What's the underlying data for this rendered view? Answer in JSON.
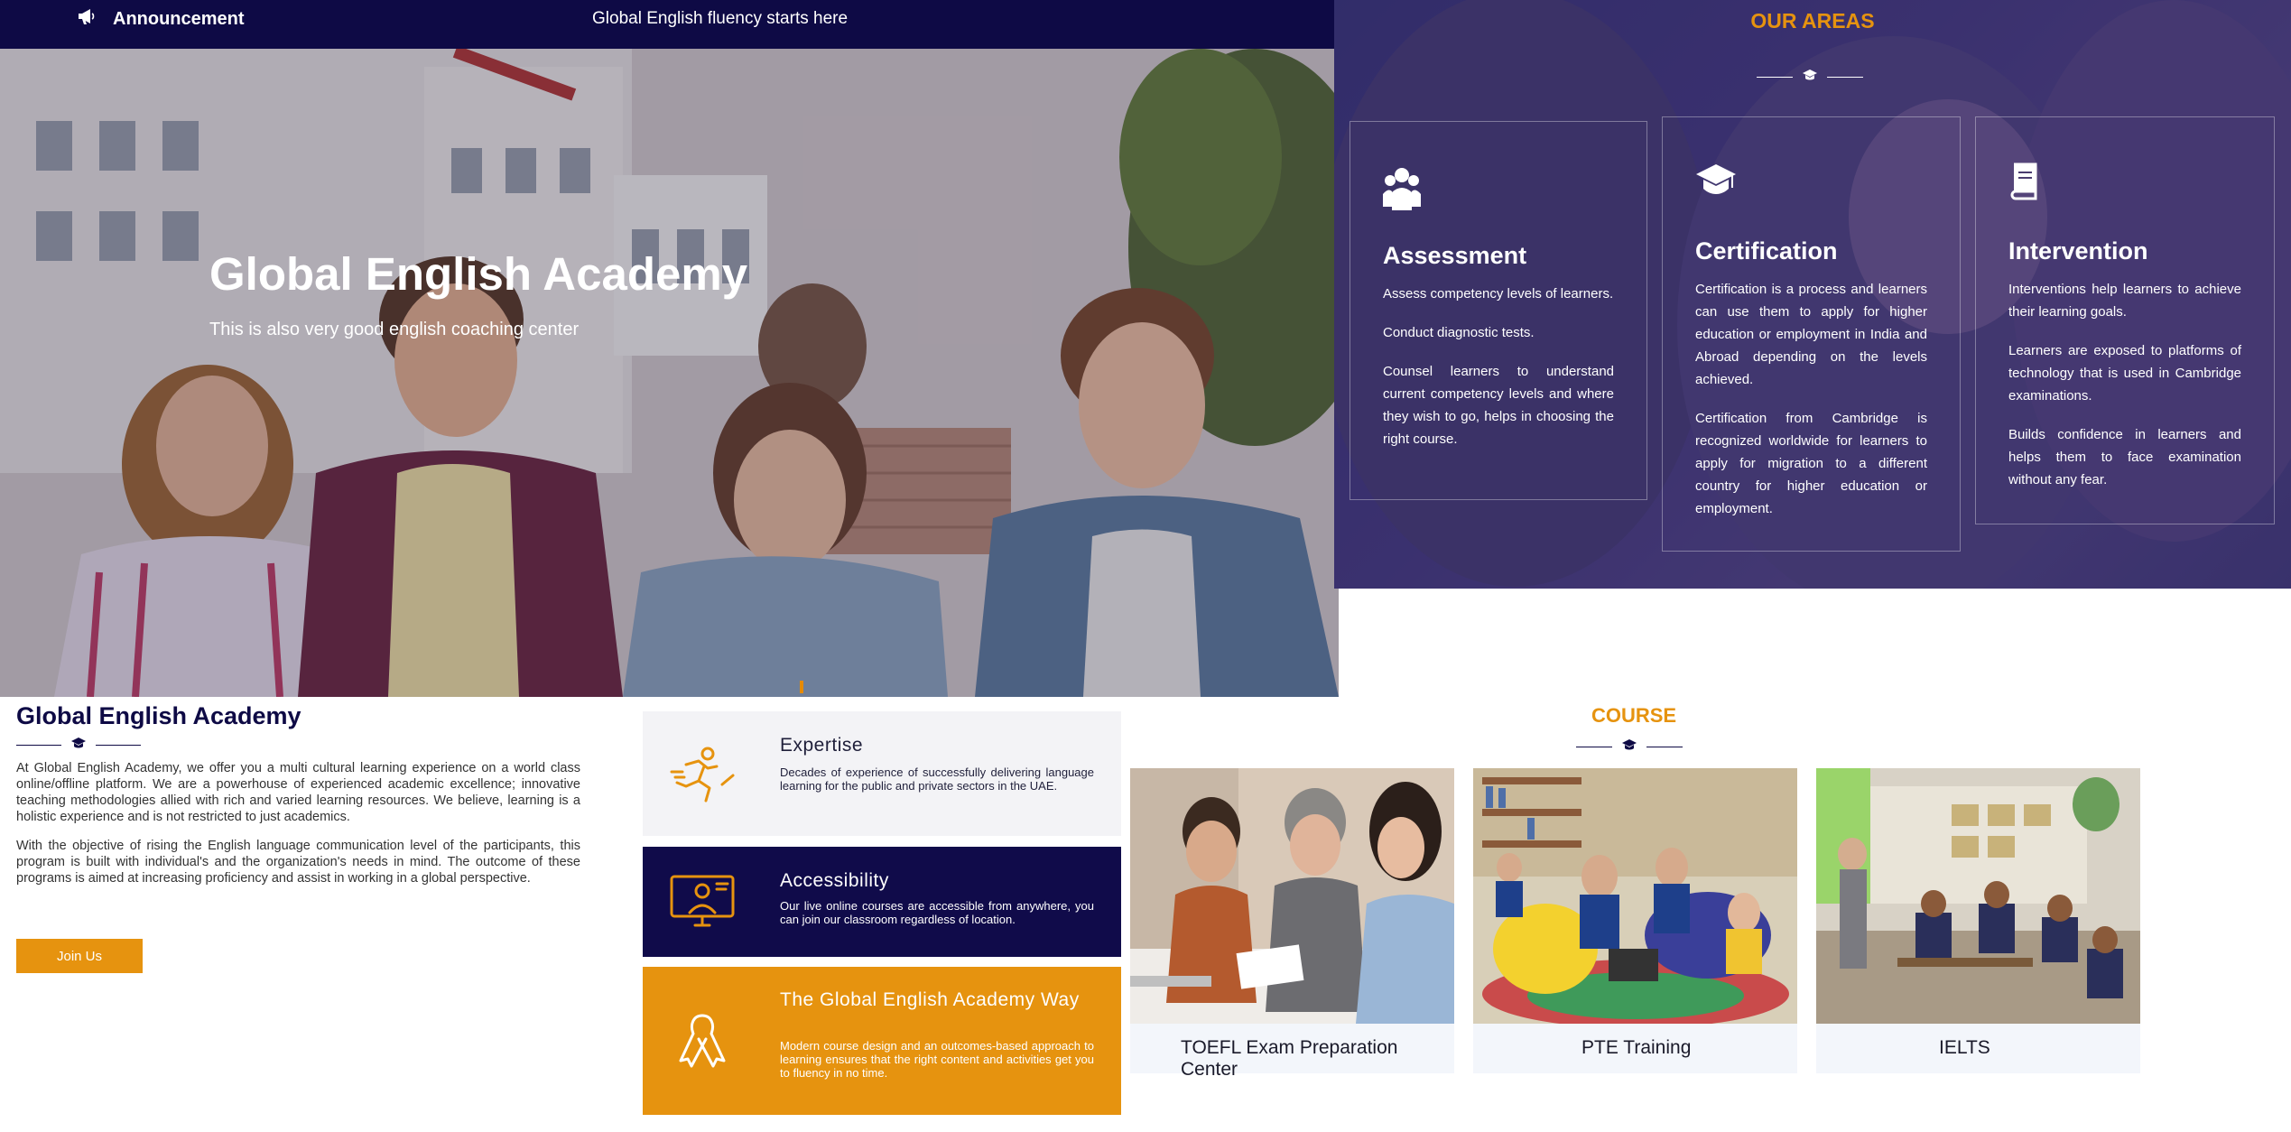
{
  "topbar": {
    "announcement": "Announcement",
    "tagline": "Global English fluency starts here"
  },
  "hero": {
    "title": "Global English Academy",
    "subtitle": "This is also very good english coaching center"
  },
  "areas": {
    "title": "OUR AREAS",
    "cards": [
      {
        "icon": "users-icon",
        "title": "Assessment",
        "paragraphs": [
          "Assess competency levels of learners.",
          "Conduct diagnostic tests.",
          "Counsel learners to understand current competency levels and where they wish to go, helps in choosing the right course."
        ]
      },
      {
        "icon": "graduation-cap-icon",
        "title": "Certification",
        "paragraphs": [
          "Certification is a process and learners can use them to apply for higher education or employment in India and Abroad depending on the levels achieved.",
          "Certification from Cambridge is recognized worldwide for learners to apply for migration to a different country for higher education or employment."
        ]
      },
      {
        "icon": "book-icon",
        "title": "Intervention",
        "paragraphs": [
          "Interventions help learners to achieve their learning goals.",
          "Learners are exposed to platforms of technology that is used in Cambridge examinations.",
          "Builds confidence in learners and helps them to face examination without any fear."
        ]
      }
    ]
  },
  "about": {
    "title": "Global English Academy",
    "paragraphs": [
      "At Global English Academy, we offer you a multi cultural learning experience on a world class online/offline platform. We are a powerhouse of experienced academic excellence; innovative teaching methodologies allied with rich and varied learning resources. We believe, learning is a holistic experience and is not restricted to just academics.",
      "With the objective of rising the English language communication level of the participants, this program is built with individual's and the organization's needs in mind. The outcome of these programs is aimed at increasing proficiency and assist in working in a global perspective."
    ],
    "join_label": "Join Us"
  },
  "features": [
    {
      "icon": "running-person-icon",
      "title": "Expertise",
      "text": "Decades of experience of successfully delivering language learning for the public and private sectors in the UAE."
    },
    {
      "icon": "online-teacher-icon",
      "title": "Accessibility",
      "text": "Our live online courses are accessible from anywhere, you can join our classroom regardless of location."
    },
    {
      "icon": "ribbon-icon",
      "title": "The Global English Academy Way",
      "text": "Modern course design and an outcomes-based approach to learning ensures that the right content and activities get you to fluency in no time."
    }
  ],
  "courses": {
    "title": "COURSE",
    "items": [
      {
        "label": "TOEFL Exam Preparation Center",
        "image": "tutoring-photo"
      },
      {
        "label": "PTE Training",
        "image": "library-students-photo"
      },
      {
        "label": "IELTS",
        "image": "classroom-photo"
      }
    ]
  },
  "colors": {
    "navy": "#0e0a45",
    "accent": "#e6930f",
    "areas_bg": "#3f3a6e"
  }
}
